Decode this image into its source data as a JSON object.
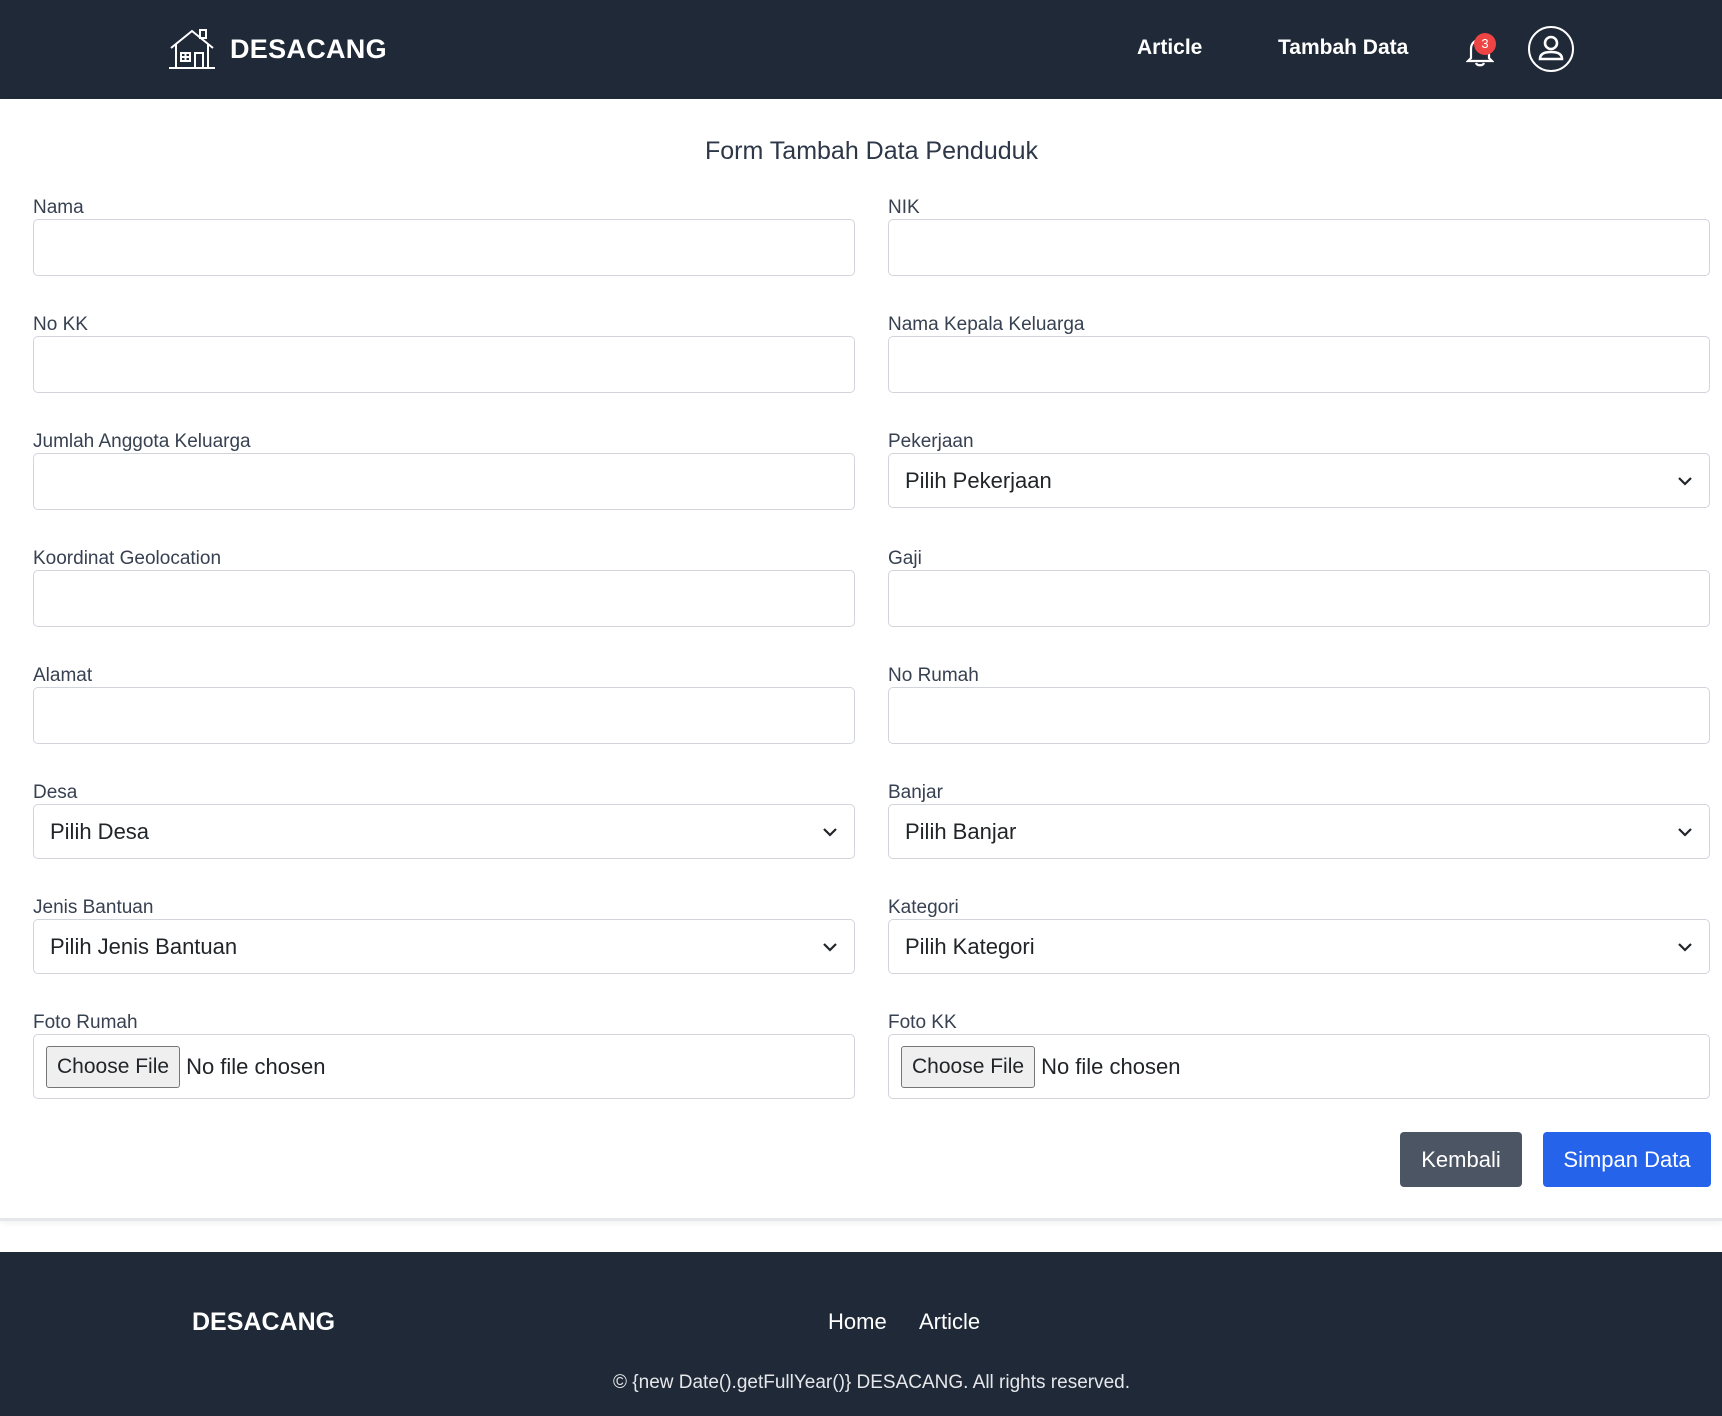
{
  "header": {
    "brand": "DESACANG",
    "nav": {
      "article": "Article",
      "tambah_data": "Tambah Data"
    },
    "notification_count": "3",
    "icons": {
      "logo": "house-icon",
      "bell": "bell-icon",
      "user": "user-circle-icon"
    }
  },
  "form": {
    "title": "Form Tambah Data Penduduk",
    "fields": {
      "nama": {
        "label": "Nama",
        "value": ""
      },
      "nik": {
        "label": "NIK",
        "value": ""
      },
      "no_kk": {
        "label": "No KK",
        "value": ""
      },
      "nama_kepala_keluarga": {
        "label": "Nama Kepala Keluarga",
        "value": ""
      },
      "jumlah_anggota_keluarga": {
        "label": "Jumlah Anggota Keluarga",
        "value": ""
      },
      "pekerjaan": {
        "label": "Pekerjaan",
        "selected": "Pilih Pekerjaan"
      },
      "koordinat_geolocation": {
        "label": "Koordinat Geolocation",
        "value": ""
      },
      "gaji": {
        "label": "Gaji",
        "value": ""
      },
      "alamat": {
        "label": "Alamat",
        "value": ""
      },
      "no_rumah": {
        "label": "No Rumah",
        "value": ""
      },
      "desa": {
        "label": "Desa",
        "selected": "Pilih Desa"
      },
      "banjar": {
        "label": "Banjar",
        "selected": "Pilih Banjar"
      },
      "jenis_bantuan": {
        "label": "Jenis Bantuan",
        "selected": "Pilih Jenis Bantuan"
      },
      "kategori": {
        "label": "Kategori",
        "selected": "Pilih Kategori"
      },
      "foto_rumah": {
        "label": "Foto Rumah",
        "button": "Choose File",
        "status": "No file chosen"
      },
      "foto_kk": {
        "label": "Foto KK",
        "button": "Choose File",
        "status": "No file chosen"
      }
    },
    "buttons": {
      "back": "Kembali",
      "save": "Simpan Data"
    }
  },
  "footer": {
    "brand": "DESACANG",
    "links": {
      "home": "Home",
      "article": "Article"
    },
    "copyright": "© {new Date().getFullYear()} DESACANG. All rights reserved."
  },
  "colors": {
    "navbar_bg": "#1f2937",
    "primary": "#2563eb",
    "secondary": "#4b5563",
    "badge": "#ef4444"
  }
}
